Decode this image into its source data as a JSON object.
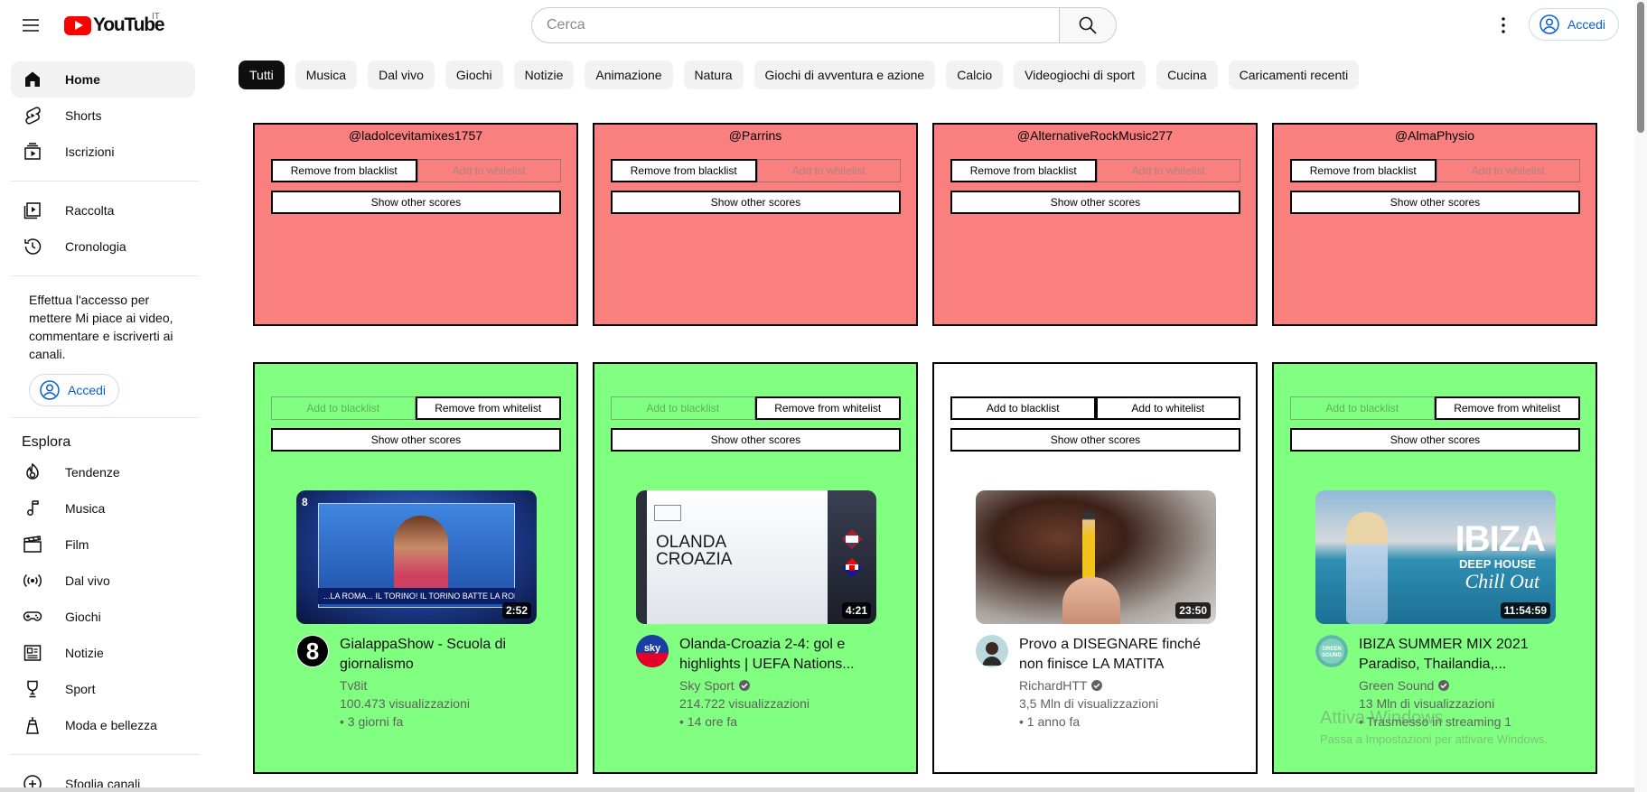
{
  "header": {
    "logo_text": "YouTube",
    "logo_country": "IT",
    "search_placeholder": "Cerca",
    "signin_label": "Accedi"
  },
  "sidebar": {
    "main": [
      {
        "label": "Home",
        "icon": "home-icon",
        "active": true
      },
      {
        "label": "Shorts",
        "icon": "shorts-icon"
      },
      {
        "label": "Iscrizioni",
        "icon": "subscriptions-icon"
      }
    ],
    "library": [
      {
        "label": "Raccolta",
        "icon": "library-icon"
      },
      {
        "label": "Cronologia",
        "icon": "history-icon"
      }
    ],
    "signin_message": "Effettua l'accesso per mettere Mi piace ai video, commentare e iscriverti ai canali.",
    "signin_label": "Accedi",
    "explore_title": "Esplora",
    "explore": [
      {
        "label": "Tendenze",
        "icon": "trending-icon"
      },
      {
        "label": "Musica",
        "icon": "music-icon"
      },
      {
        "label": "Film",
        "icon": "film-icon"
      },
      {
        "label": "Dal vivo",
        "icon": "live-icon"
      },
      {
        "label": "Giochi",
        "icon": "gaming-icon"
      },
      {
        "label": "Notizie",
        "icon": "news-icon"
      },
      {
        "label": "Sport",
        "icon": "sport-icon"
      },
      {
        "label": "Moda e bellezza",
        "icon": "fashion-icon"
      }
    ],
    "more_label": "Sfoglia canali"
  },
  "chips": [
    "Tutti",
    "Musica",
    "Dal vivo",
    "Giochi",
    "Notizie",
    "Animazione",
    "Natura",
    "Giochi di avventura e azione",
    "Calcio",
    "Videogiochi di sport",
    "Cucina",
    "Caricamenti recenti"
  ],
  "blocked_cards": [
    {
      "channel": "@ladolcevitamixes1757",
      "btn_left": "Remove from blacklist",
      "btn_right": "Add to whitelist",
      "show_scores": "Show other scores"
    },
    {
      "channel": "@Parrins",
      "btn_left": "Remove from blacklist",
      "btn_right": "Add to whitelist",
      "show_scores": "Show other scores"
    },
    {
      "channel": "@AlternativeRockMusic277",
      "btn_left": "Remove from blacklist",
      "btn_right": "Add to whitelist",
      "show_scores": "Show other scores"
    },
    {
      "channel": "@AlmaPhysio",
      "btn_left": "Remove from blacklist",
      "btn_right": "Add to whitelist",
      "show_scores": "Show other scores"
    }
  ],
  "video_cards": [
    {
      "status": "whitelisted",
      "btn_left": "Add to blacklist",
      "btn_right": "Remove from whitelist",
      "show_scores": "Show other scores",
      "duration": "2:52",
      "title": "GialappaShow - Scuola di giornalismo",
      "channel": "Tv8it",
      "views": "100.473 visualizzazioni",
      "age": "• 3 giorni fa",
      "thumb_caption": "...LA ROMA... IL TORINO! IL TORINO BATTE LA ROMA...",
      "avatar_text": "8"
    },
    {
      "status": "whitelisted",
      "btn_left": "Add to blacklist",
      "btn_right": "Remove from whitelist",
      "show_scores": "Show other scores",
      "duration": "4:21",
      "title": "Olanda-Croazia 2-4: gol e highlights | UEFA Nations...",
      "channel": "Sky Sport",
      "views": "214.722 visualizzazioni",
      "age": "• 14 ore fa",
      "thumb_line1": "OLANDA",
      "thumb_line2": "CROAZIA",
      "avatar_text": "sky"
    },
    {
      "status": "neutral",
      "btn_left": "Add to blacklist",
      "btn_right": "Add to whitelist",
      "show_scores": "Show other scores",
      "duration": "23:50",
      "title": "Provo a DISEGNARE finché non finisce LA MATITA",
      "channel": "RichardHTT",
      "views": "3,5 Mln di visualizzazioni",
      "age": "• 1 anno fa"
    },
    {
      "status": "whitelisted",
      "btn_left": "Add to blacklist",
      "btn_right": "Remove from whitelist",
      "show_scores": "Show other scores",
      "duration": "11:54:59",
      "title": "IBIZA SUMMER MIX 2021 Paradiso, Thailandia,...",
      "channel": "Green Sound",
      "views": "13 Mln di visualizzazioni",
      "age": "• Trasmesso in streaming 1",
      "thumb_line1": "IBIZA",
      "thumb_line2": "DEEP HOUSE",
      "thumb_line3": "Chill Out",
      "avatar_text": "GREEN SOUND"
    }
  ],
  "watermark": {
    "line1": "Attiva Windows",
    "line2": "Passa a Impostazioni per attivare Windows."
  },
  "colors": {
    "blacklisted": "#fa8080",
    "whitelisted": "#80ff80",
    "neutral": "#ffffff",
    "brand_red": "#ff0000",
    "link_blue": "#065fd4"
  }
}
